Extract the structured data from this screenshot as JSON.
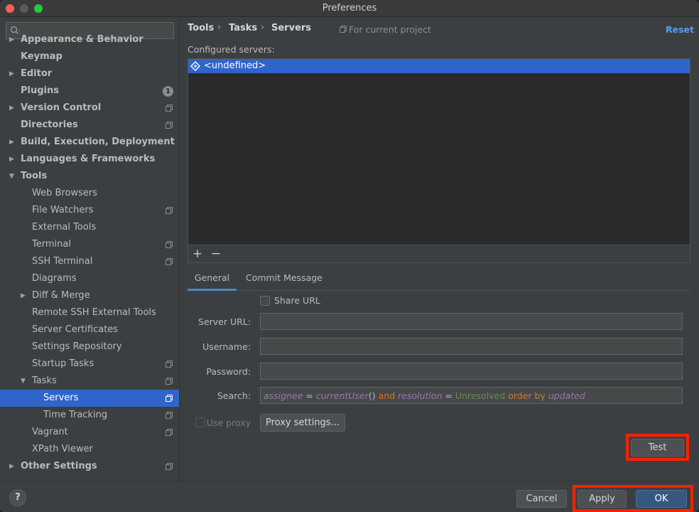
{
  "window": {
    "title": "Preferences"
  },
  "search": {
    "placeholder": ""
  },
  "sidebar": {
    "items": [
      {
        "label": "Appearance & Behavior",
        "level": 0,
        "arrow": "right",
        "bold": true
      },
      {
        "label": "Keymap",
        "level": 0,
        "arrow": "",
        "bold": true
      },
      {
        "label": "Editor",
        "level": 0,
        "arrow": "right",
        "bold": true
      },
      {
        "label": "Plugins",
        "level": 0,
        "arrow": "",
        "bold": true,
        "badge": "1"
      },
      {
        "label": "Version Control",
        "level": 0,
        "arrow": "right",
        "bold": true,
        "project": true
      },
      {
        "label": "Directories",
        "level": 0,
        "arrow": "",
        "bold": true,
        "project": true
      },
      {
        "label": "Build, Execution, Deployment",
        "level": 0,
        "arrow": "right",
        "bold": true
      },
      {
        "label": "Languages & Frameworks",
        "level": 0,
        "arrow": "right",
        "bold": true
      },
      {
        "label": "Tools",
        "level": 0,
        "arrow": "down",
        "bold": true
      },
      {
        "label": "Web Browsers",
        "level": 1,
        "arrow": ""
      },
      {
        "label": "File Watchers",
        "level": 1,
        "arrow": "",
        "project": true
      },
      {
        "label": "External Tools",
        "level": 1,
        "arrow": ""
      },
      {
        "label": "Terminal",
        "level": 1,
        "arrow": "",
        "project": true
      },
      {
        "label": "SSH Terminal",
        "level": 1,
        "arrow": "",
        "project": true
      },
      {
        "label": "Diagrams",
        "level": 1,
        "arrow": ""
      },
      {
        "label": "Diff & Merge",
        "level": 1,
        "arrow": "right"
      },
      {
        "label": "Remote SSH External Tools",
        "level": 1,
        "arrow": ""
      },
      {
        "label": "Server Certificates",
        "level": 1,
        "arrow": ""
      },
      {
        "label": "Settings Repository",
        "level": 1,
        "arrow": ""
      },
      {
        "label": "Startup Tasks",
        "level": 1,
        "arrow": "",
        "project": true
      },
      {
        "label": "Tasks",
        "level": 1,
        "arrow": "down",
        "project": true
      },
      {
        "label": "Servers",
        "level": 2,
        "arrow": "",
        "project": true,
        "selected": true
      },
      {
        "label": "Time Tracking",
        "level": 2,
        "arrow": "",
        "project": true
      },
      {
        "label": "Vagrant",
        "level": 1,
        "arrow": "",
        "project": true
      },
      {
        "label": "XPath Viewer",
        "level": 1,
        "arrow": ""
      },
      {
        "label": "Other Settings",
        "level": 0,
        "arrow": "right",
        "bold": true,
        "project": true
      }
    ]
  },
  "breadcrumb": {
    "items": [
      "Tools",
      "Tasks",
      "Servers"
    ],
    "scope": "For current project",
    "reset": "Reset"
  },
  "servers": {
    "label": "Configured servers:",
    "items": [
      "<undefined>"
    ],
    "add": "+",
    "remove": "−"
  },
  "tabs": [
    {
      "label": "General",
      "active": true
    },
    {
      "label": "Commit Message",
      "active": false
    }
  ],
  "form": {
    "share_url": "Share URL",
    "server_url": {
      "label": "Server URL:",
      "value": ""
    },
    "username": {
      "label": "Username:",
      "value": ""
    },
    "password": {
      "label": "Password:",
      "value": ""
    },
    "search": {
      "label": "Search:",
      "tokens": [
        {
          "t": "assignee",
          "c": "q-field"
        },
        {
          "t": " = ",
          "c": "q-op"
        },
        {
          "t": "currentUser",
          "c": "q-fn"
        },
        {
          "t": "()",
          "c": "q-op"
        },
        {
          "t": " and ",
          "c": "q-kw"
        },
        {
          "t": "resolution",
          "c": "q-field"
        },
        {
          "t": " = ",
          "c": "q-op"
        },
        {
          "t": "Unresolved",
          "c": "q-val"
        },
        {
          "t": " order by ",
          "c": "q-kw"
        },
        {
          "t": "updated",
          "c": "q-field"
        }
      ]
    },
    "use_proxy": "Use proxy",
    "proxy_settings": "Proxy settings...",
    "test": "Test"
  },
  "footer": {
    "help": "?",
    "cancel": "Cancel",
    "apply": "Apply",
    "ok": "OK"
  },
  "colors": {
    "accent": "#2f65ca",
    "highlight": "#ff1f00",
    "link": "#589df6"
  }
}
